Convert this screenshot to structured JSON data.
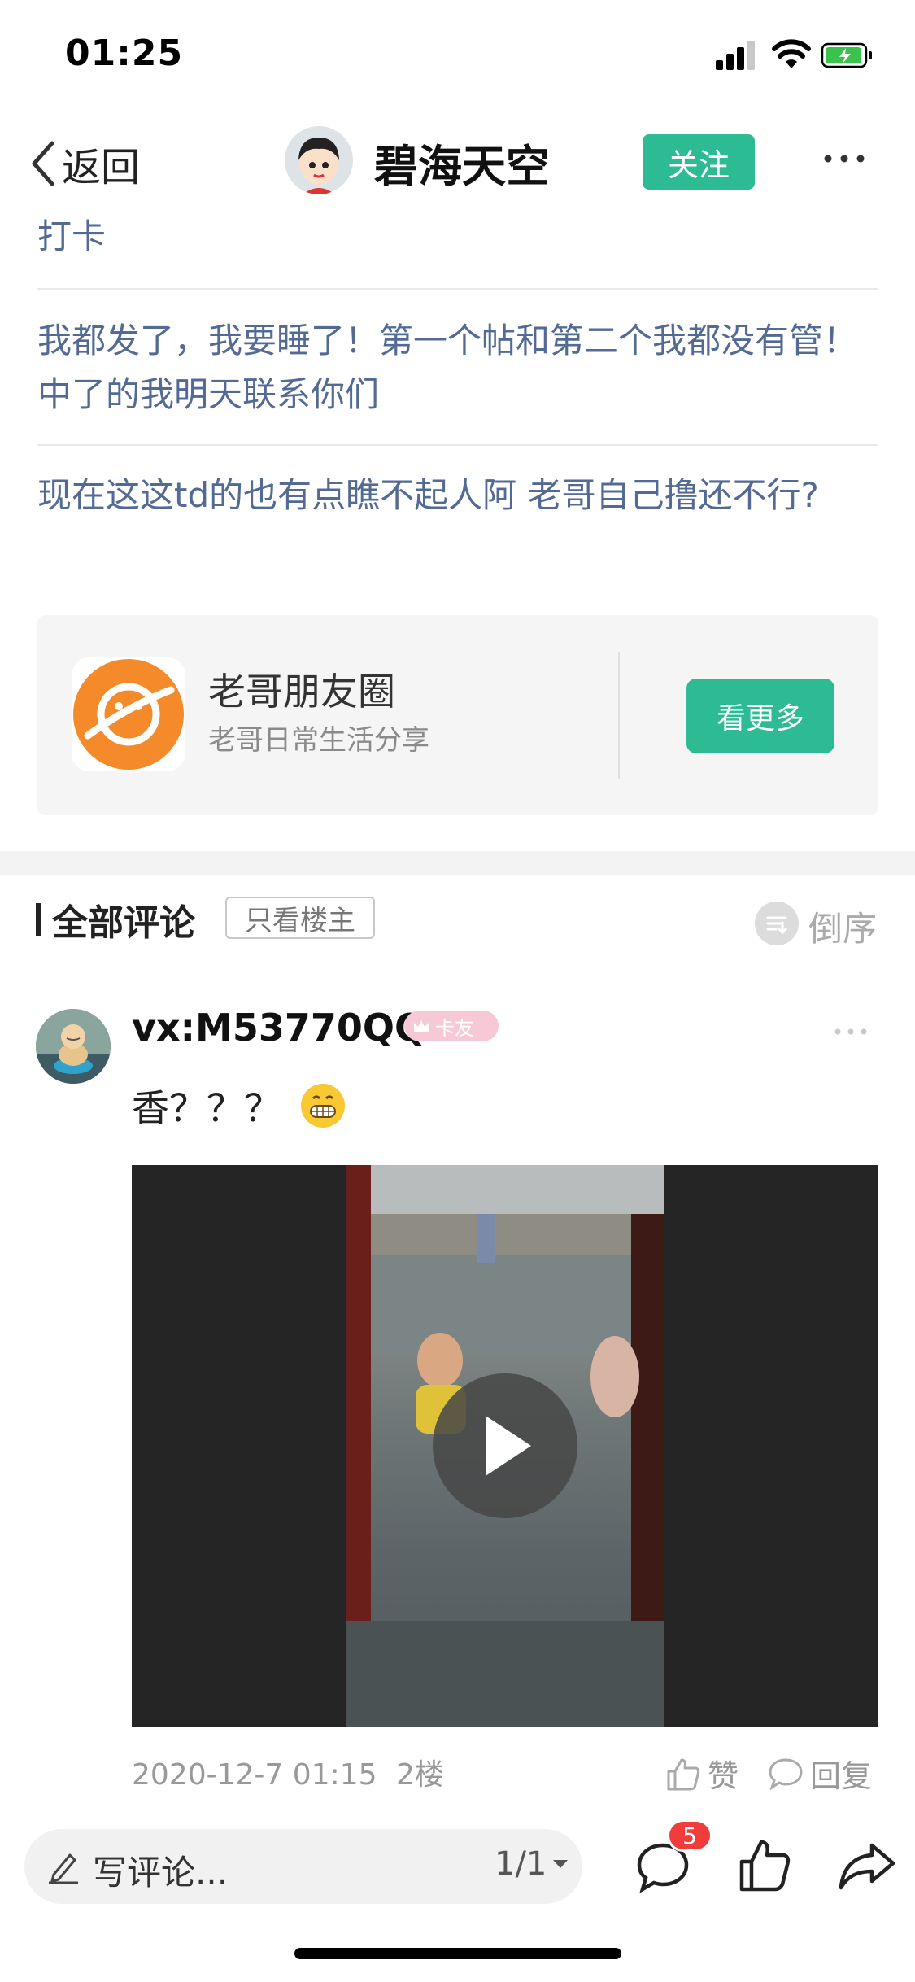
{
  "status_bar": {
    "time": "01:25"
  },
  "header": {
    "back_label": "返回",
    "author_name": "碧海天空",
    "follow_label": "关注"
  },
  "post": {
    "paragraphs": [
      "打卡",
      "我都发了，我要睡了！第一个帖和第二个我都没有管！中了的我明天联系你们",
      "现在这这td的也有点瞧不起人阿 老哥自己撸还不行?"
    ],
    "card": {
      "title": "老哥朋友圈",
      "subtitle": "老哥日常生活分享",
      "button_label": "看更多"
    }
  },
  "comments_header": {
    "title": "全部评论",
    "op_only_label": "只看楼主",
    "sort_label": "倒序"
  },
  "comment": {
    "username": "vx:M53770QQ",
    "badge": "卡友",
    "text": "香？？？",
    "timestamp": "2020-12-7 01:15",
    "floor": "2楼",
    "like_label": "赞",
    "reply_label": "回复"
  },
  "bottom_bar": {
    "input_placeholder": "写评论...",
    "page_indicator": "1/1",
    "comment_count": "5"
  },
  "colors": {
    "accent": "#2dbb94",
    "link_text": "#536b94",
    "notification_red": "#f23b3b"
  },
  "icons": [
    "signal-icon",
    "wifi-icon",
    "battery-icon",
    "back-chevron-icon",
    "more-icon",
    "planet-logo-icon",
    "sort-icon",
    "crown-icon",
    "grin-emoji-icon",
    "play-icon",
    "thumbs-up-icon",
    "speech-bubble-icon",
    "pencil-icon",
    "caret-down-icon",
    "share-arrow-icon"
  ]
}
